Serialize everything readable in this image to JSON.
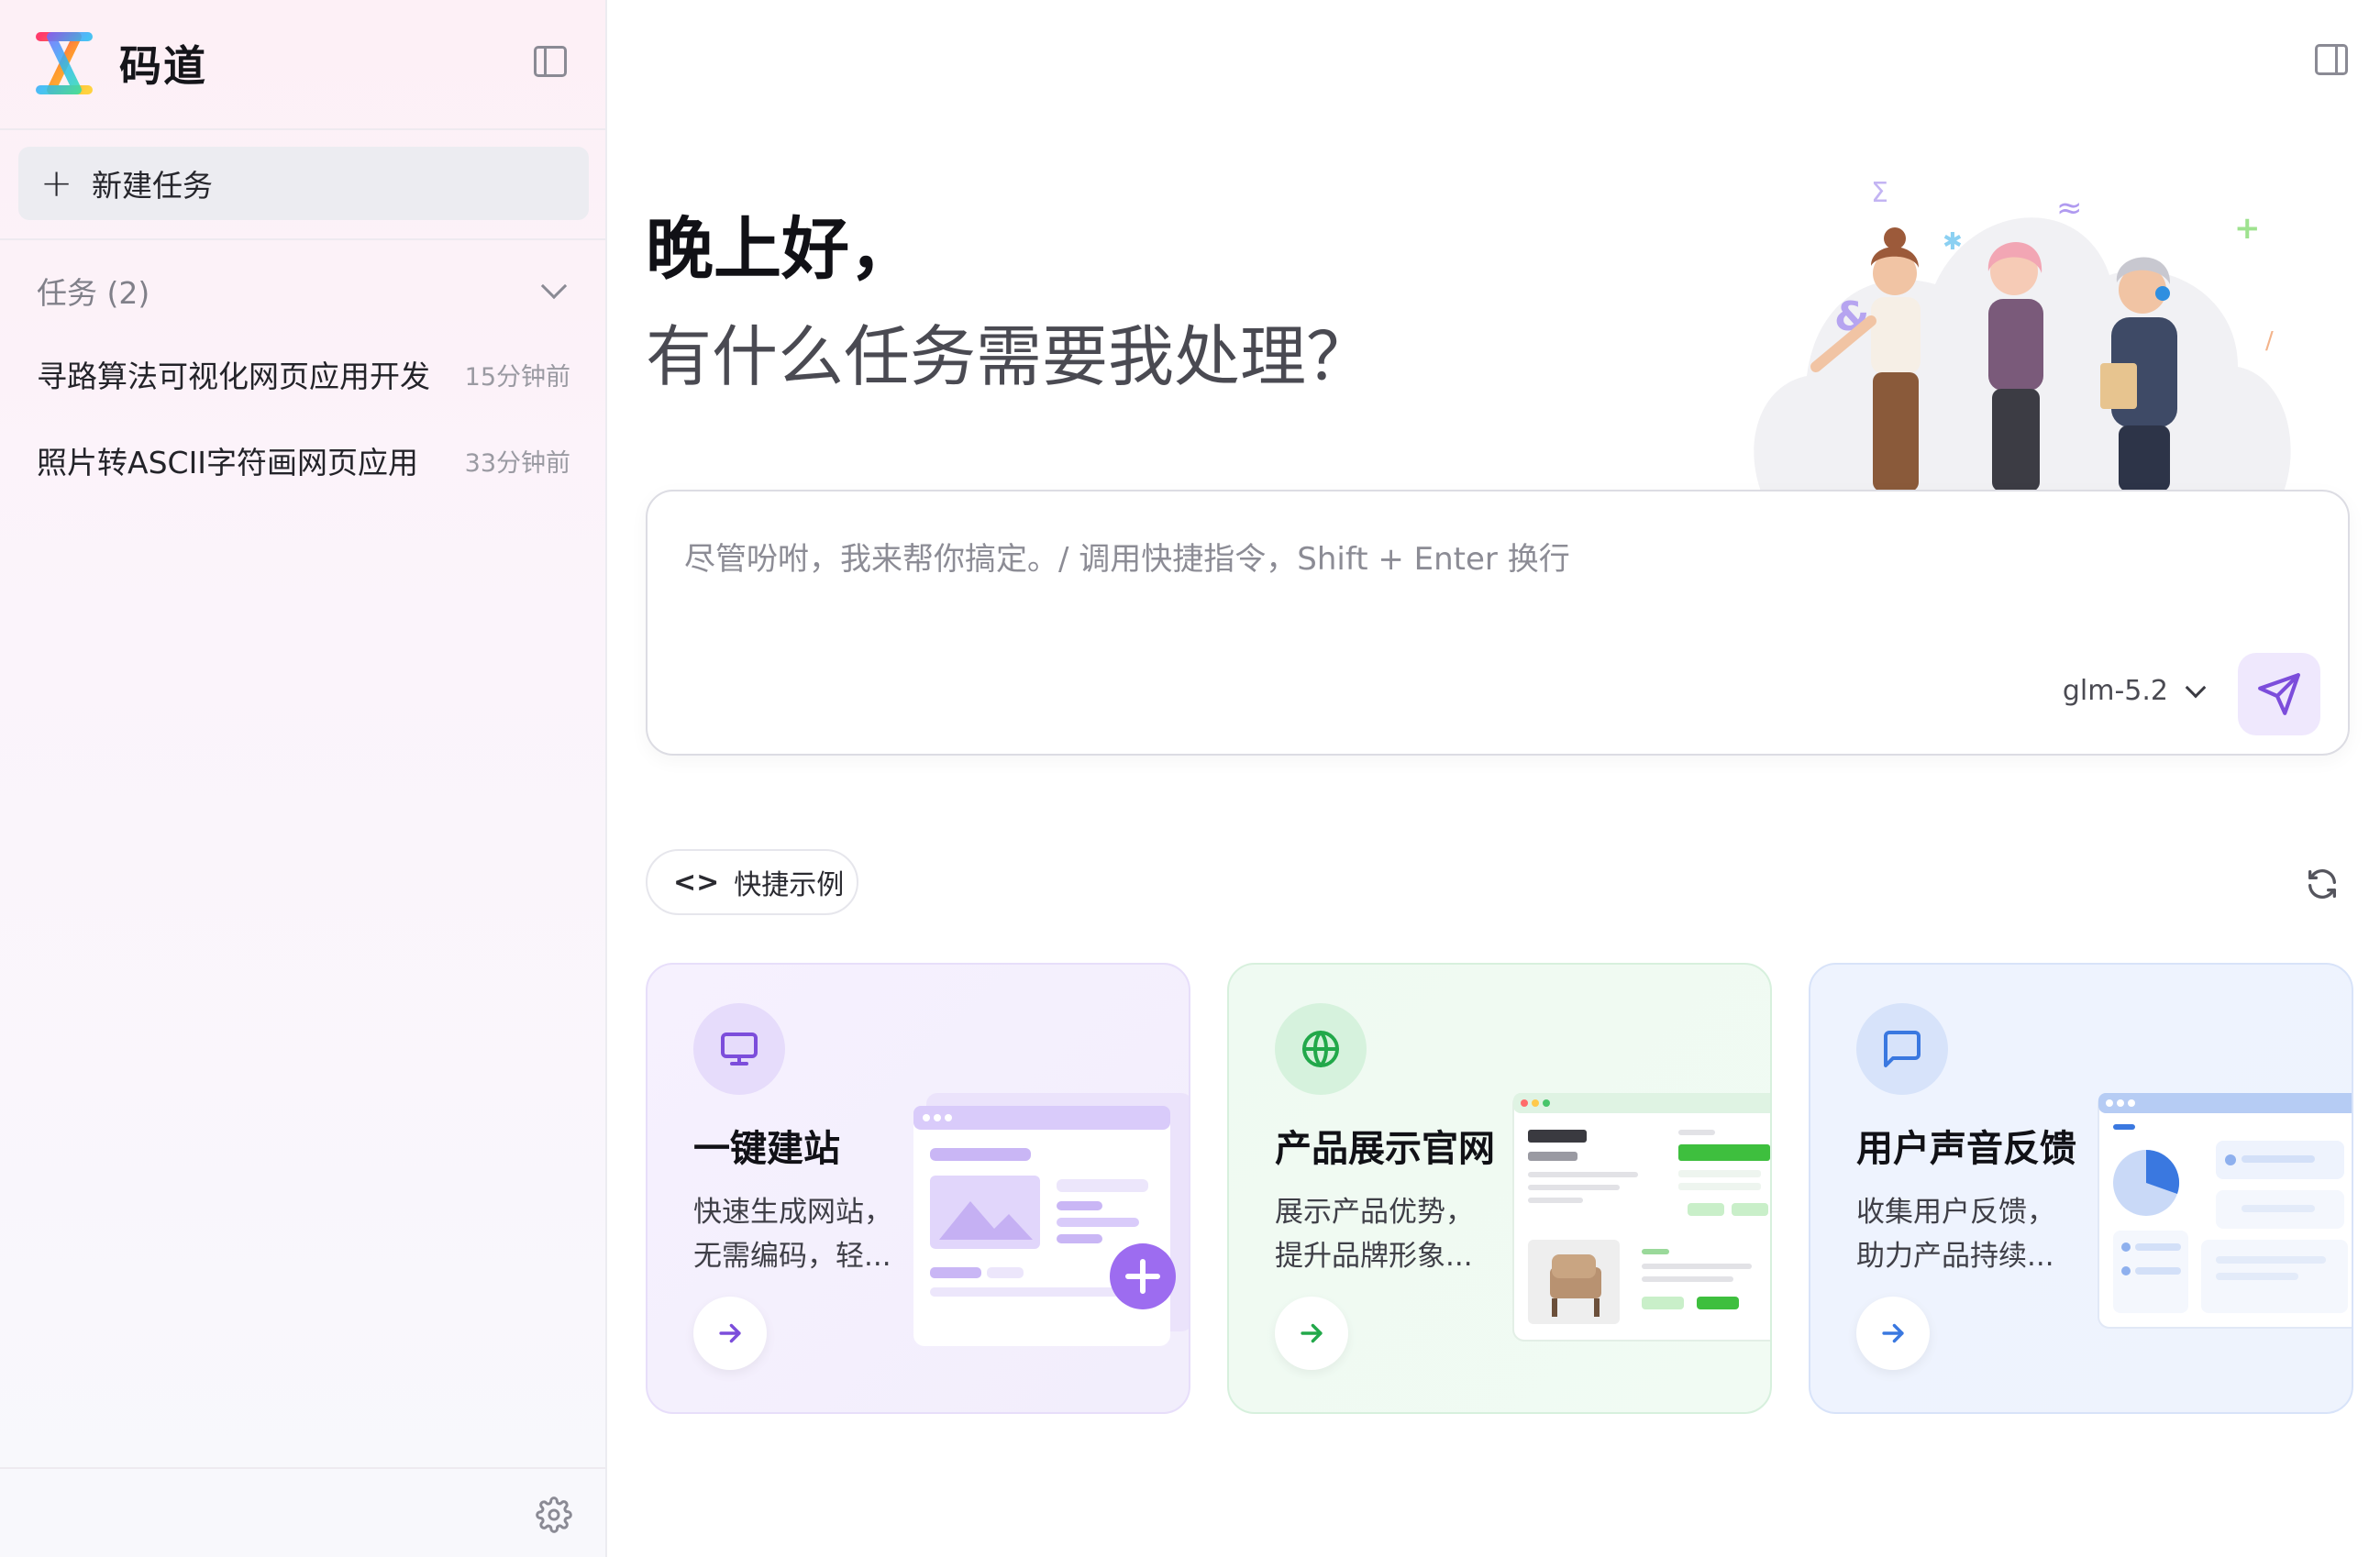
{
  "sidebar": {
    "app_name": "码道",
    "new_task_label": "新建任务",
    "group_label": "任务 (2)",
    "tasks": [
      {
        "title": "寻路算法可视化网页应用开发",
        "time": "15分钟前"
      },
      {
        "title": "照片转ASCII字符画网页应用",
        "time": "33分钟前"
      }
    ]
  },
  "main": {
    "greeting": "晚上好，",
    "question": "有什么任务需要我处理？",
    "composer": {
      "placeholder": "尽管吩咐，我来帮你搞定。/ 调用快捷指令，Shift + Enter 换行",
      "model": "glm-5.2"
    },
    "examples_label": "快捷示例",
    "cards": [
      {
        "title": "一键建站",
        "desc_line1": "快速生成网站，",
        "desc_line2": "无需编码，轻..."
      },
      {
        "title": "产品展示官网",
        "desc_line1": "展示产品优势，",
        "desc_line2": "提升品牌形象..."
      },
      {
        "title": "用户声音反馈",
        "desc_line1": "收集用户反馈，",
        "desc_line2": "助力产品持续..."
      }
    ]
  },
  "colors": {
    "accent": "#7c4ddb",
    "green": "#22a84a",
    "blue": "#3a78e0"
  }
}
